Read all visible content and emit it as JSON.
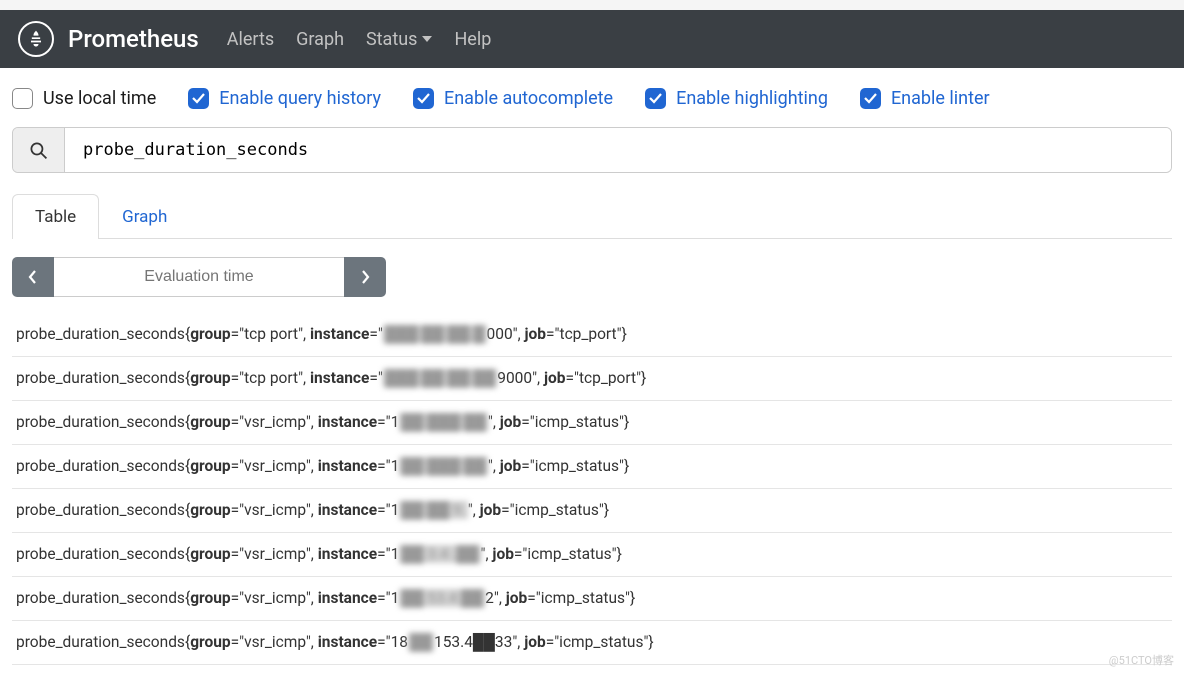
{
  "nav": {
    "brand": "Prometheus",
    "links": [
      "Alerts",
      "Graph",
      "Status",
      "Help"
    ]
  },
  "options": {
    "use_local_time": {
      "label": "Use local time",
      "checked": false
    },
    "query_history": {
      "label": "Enable query history",
      "checked": true
    },
    "autocomplete": {
      "label": "Enable autocomplete",
      "checked": true
    },
    "highlighting": {
      "label": "Enable highlighting",
      "checked": true
    },
    "linter": {
      "label": "Enable linter",
      "checked": true
    }
  },
  "query": {
    "value": "probe_duration_seconds"
  },
  "tabs": {
    "table": "Table",
    "graph": "Graph",
    "active": "table"
  },
  "eval": {
    "placeholder": "Evaluation time"
  },
  "results": [
    {
      "metric": "probe_duration_seconds",
      "group": "tcp port",
      "instance_prefix": "",
      "instance_mid": "███ ██ ██.█",
      "instance_suffix": "000",
      "job": "tcp_port"
    },
    {
      "metric": "probe_duration_seconds",
      "group": "tcp port",
      "instance_prefix": "",
      "instance_mid": "███ ██ ██ ██",
      "instance_suffix": "9000",
      "job": "tcp_port"
    },
    {
      "metric": "probe_duration_seconds",
      "group": "vsr_icmp",
      "instance_prefix": "1",
      "instance_mid": "██ ███ ██",
      "instance_suffix": "",
      "job": "icmp_status"
    },
    {
      "metric": "probe_duration_seconds",
      "group": "vsr_icmp",
      "instance_prefix": "1",
      "instance_mid": "██ ███ ██",
      "instance_suffix": "",
      "job": "icmp_status"
    },
    {
      "metric": "probe_duration_seconds",
      "group": "vsr_icmp",
      "instance_prefix": "1",
      "instance_mid": "██ ██ 9.",
      "instance_suffix": "",
      "job": "icmp_status"
    },
    {
      "metric": "probe_duration_seconds",
      "group": "vsr_icmp",
      "instance_prefix": "1",
      "instance_mid": "██ 3.4 .██",
      "instance_suffix": "",
      "job": "icmp_status"
    },
    {
      "metric": "probe_duration_seconds",
      "group": "vsr_icmp",
      "instance_prefix": "1",
      "instance_mid": "██ 53.4 ██",
      "instance_suffix": "2",
      "job": "icmp_status"
    },
    {
      "metric": "probe_duration_seconds",
      "group": "vsr_icmp",
      "instance_prefix": "18",
      "instance_mid": "██",
      "instance_suffix": "153.4██33",
      "job": "icmp_status"
    }
  ],
  "watermark": "@51CTO博客"
}
